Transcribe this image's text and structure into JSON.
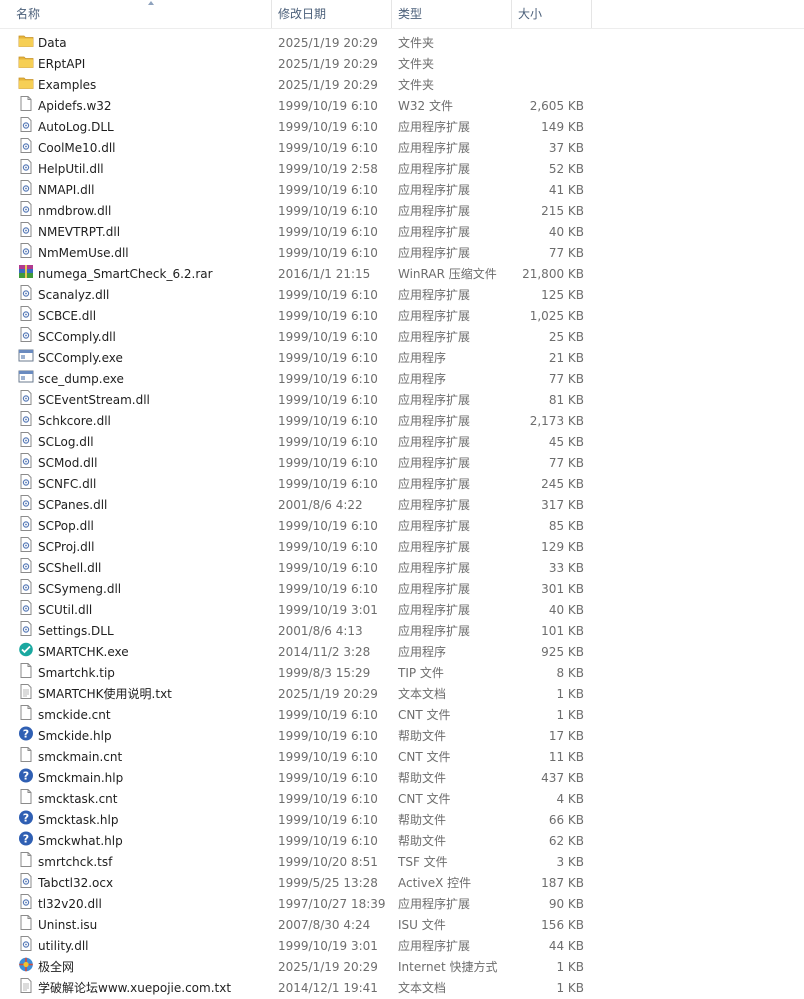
{
  "columns": {
    "name": "名称",
    "date": "修改日期",
    "type": "类型",
    "size": "大小"
  },
  "files": [
    {
      "name": "Data",
      "date": "2025/1/19 20:29",
      "type": "文件夹",
      "size": "",
      "icon": "folder-icon"
    },
    {
      "name": "ERptAPI",
      "date": "2025/1/19 20:29",
      "type": "文件夹",
      "size": "",
      "icon": "folder-icon"
    },
    {
      "name": "Examples",
      "date": "2025/1/19 20:29",
      "type": "文件夹",
      "size": "",
      "icon": "folder-icon"
    },
    {
      "name": "Apidefs.w32",
      "date": "1999/10/19 6:10",
      "type": "W32 文件",
      "size": "2,605 KB",
      "icon": "file-icon"
    },
    {
      "name": "AutoLog.DLL",
      "date": "1999/10/19 6:10",
      "type": "应用程序扩展",
      "size": "149 KB",
      "icon": "dll-icon"
    },
    {
      "name": "CoolMe10.dll",
      "date": "1999/10/19 6:10",
      "type": "应用程序扩展",
      "size": "37 KB",
      "icon": "dll-icon"
    },
    {
      "name": "HelpUtil.dll",
      "date": "1999/10/19 2:58",
      "type": "应用程序扩展",
      "size": "52 KB",
      "icon": "dll-icon"
    },
    {
      "name": "NMAPI.dll",
      "date": "1999/10/19 6:10",
      "type": "应用程序扩展",
      "size": "41 KB",
      "icon": "dll-icon"
    },
    {
      "name": "nmdbrow.dll",
      "date": "1999/10/19 6:10",
      "type": "应用程序扩展",
      "size": "215 KB",
      "icon": "dll-icon"
    },
    {
      "name": "NMEVTRPT.dll",
      "date": "1999/10/19 6:10",
      "type": "应用程序扩展",
      "size": "40 KB",
      "icon": "dll-icon"
    },
    {
      "name": "NmMemUse.dll",
      "date": "1999/10/19 6:10",
      "type": "应用程序扩展",
      "size": "77 KB",
      "icon": "dll-icon"
    },
    {
      "name": "numega_SmartCheck_6.2.rar",
      "date": "2016/1/1 21:15",
      "type": "WinRAR 压缩文件",
      "size": "21,800 KB",
      "icon": "rar-icon"
    },
    {
      "name": "Scanalyz.dll",
      "date": "1999/10/19 6:10",
      "type": "应用程序扩展",
      "size": "125 KB",
      "icon": "dll-icon"
    },
    {
      "name": "SCBCE.dll",
      "date": "1999/10/19 6:10",
      "type": "应用程序扩展",
      "size": "1,025 KB",
      "icon": "dll-icon"
    },
    {
      "name": "SCComply.dll",
      "date": "1999/10/19 6:10",
      "type": "应用程序扩展",
      "size": "25 KB",
      "icon": "dll-icon"
    },
    {
      "name": "SCComply.exe",
      "date": "1999/10/19 6:10",
      "type": "应用程序",
      "size": "21 KB",
      "icon": "exe-icon"
    },
    {
      "name": "sce_dump.exe",
      "date": "1999/10/19 6:10",
      "type": "应用程序",
      "size": "77 KB",
      "icon": "exe-icon"
    },
    {
      "name": "SCEventStream.dll",
      "date": "1999/10/19 6:10",
      "type": "应用程序扩展",
      "size": "81 KB",
      "icon": "dll-icon"
    },
    {
      "name": "Schkcore.dll",
      "date": "1999/10/19 6:10",
      "type": "应用程序扩展",
      "size": "2,173 KB",
      "icon": "dll-icon"
    },
    {
      "name": "SCLog.dll",
      "date": "1999/10/19 6:10",
      "type": "应用程序扩展",
      "size": "45 KB",
      "icon": "dll-icon"
    },
    {
      "name": "SCMod.dll",
      "date": "1999/10/19 6:10",
      "type": "应用程序扩展",
      "size": "77 KB",
      "icon": "dll-icon"
    },
    {
      "name": "SCNFC.dll",
      "date": "1999/10/19 6:10",
      "type": "应用程序扩展",
      "size": "245 KB",
      "icon": "dll-icon"
    },
    {
      "name": "SCPanes.dll",
      "date": "2001/8/6 4:22",
      "type": "应用程序扩展",
      "size": "317 KB",
      "icon": "dll-icon"
    },
    {
      "name": "SCPop.dll",
      "date": "1999/10/19 6:10",
      "type": "应用程序扩展",
      "size": "85 KB",
      "icon": "dll-icon"
    },
    {
      "name": "SCProj.dll",
      "date": "1999/10/19 6:10",
      "type": "应用程序扩展",
      "size": "129 KB",
      "icon": "dll-icon"
    },
    {
      "name": "SCShell.dll",
      "date": "1999/10/19 6:10",
      "type": "应用程序扩展",
      "size": "33 KB",
      "icon": "dll-icon"
    },
    {
      "name": "SCSymeng.dll",
      "date": "1999/10/19 6:10",
      "type": "应用程序扩展",
      "size": "301 KB",
      "icon": "dll-icon"
    },
    {
      "name": "SCUtil.dll",
      "date": "1999/10/19 3:01",
      "type": "应用程序扩展",
      "size": "40 KB",
      "icon": "dll-icon"
    },
    {
      "name": "Settings.DLL",
      "date": "2001/8/6 4:13",
      "type": "应用程序扩展",
      "size": "101 KB",
      "icon": "dll-icon"
    },
    {
      "name": "SMARTCHK.exe",
      "date": "2014/11/2 3:28",
      "type": "应用程序",
      "size": "925 KB",
      "icon": "smartcheck-app-icon"
    },
    {
      "name": "Smartchk.tip",
      "date": "1999/8/3 15:29",
      "type": "TIP 文件",
      "size": "8 KB",
      "icon": "file-icon"
    },
    {
      "name": "SMARTCHK使用说明.txt",
      "date": "2025/1/19 20:29",
      "type": "文本文档",
      "size": "1 KB",
      "icon": "text-file-icon"
    },
    {
      "name": "smckide.cnt",
      "date": "1999/10/19 6:10",
      "type": "CNT 文件",
      "size": "1 KB",
      "icon": "file-icon"
    },
    {
      "name": "Smckide.hlp",
      "date": "1999/10/19 6:10",
      "type": "帮助文件",
      "size": "17 KB",
      "icon": "help-icon"
    },
    {
      "name": "smckmain.cnt",
      "date": "1999/10/19 6:10",
      "type": "CNT 文件",
      "size": "11 KB",
      "icon": "file-icon"
    },
    {
      "name": "Smckmain.hlp",
      "date": "1999/10/19 6:10",
      "type": "帮助文件",
      "size": "437 KB",
      "icon": "help-icon"
    },
    {
      "name": "smcktask.cnt",
      "date": "1999/10/19 6:10",
      "type": "CNT 文件",
      "size": "4 KB",
      "icon": "file-icon"
    },
    {
      "name": "Smcktask.hlp",
      "date": "1999/10/19 6:10",
      "type": "帮助文件",
      "size": "66 KB",
      "icon": "help-icon"
    },
    {
      "name": "Smckwhat.hlp",
      "date": "1999/10/19 6:10",
      "type": "帮助文件",
      "size": "62 KB",
      "icon": "help-icon"
    },
    {
      "name": "smrtchck.tsf",
      "date": "1999/10/20 8:51",
      "type": "TSF 文件",
      "size": "3 KB",
      "icon": "file-icon"
    },
    {
      "name": "Tabctl32.ocx",
      "date": "1999/5/25 13:28",
      "type": "ActiveX 控件",
      "size": "187 KB",
      "icon": "dll-icon"
    },
    {
      "name": "tl32v20.dll",
      "date": "1997/10/27 18:39",
      "type": "应用程序扩展",
      "size": "90 KB",
      "icon": "dll-icon"
    },
    {
      "name": "Uninst.isu",
      "date": "2007/8/30 4:24",
      "type": "ISU 文件",
      "size": "156 KB",
      "icon": "file-icon"
    },
    {
      "name": "utility.dll",
      "date": "1999/10/19 3:01",
      "type": "应用程序扩展",
      "size": "44 KB",
      "icon": "dll-icon"
    },
    {
      "name": "极全网",
      "date": "2025/1/19 20:29",
      "type": "Internet 快捷方式",
      "size": "1 KB",
      "icon": "internet-shortcut-icon"
    },
    {
      "name": "学破解论坛www.xuepojie.com.txt",
      "date": "2014/12/1 19:41",
      "type": "文本文档",
      "size": "1 KB",
      "icon": "text-file-icon"
    }
  ]
}
